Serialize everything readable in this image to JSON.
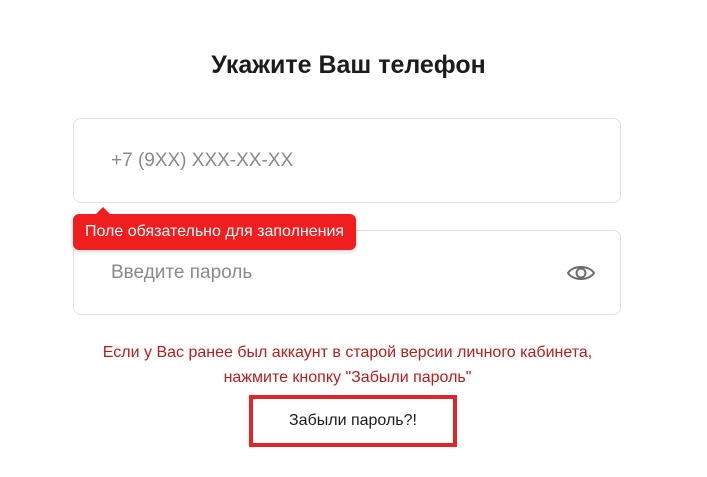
{
  "title": "Укажите Ваш телефон",
  "phone_field": {
    "value": "",
    "placeholder": "+7 (9XX) XXX-XX-XX"
  },
  "validation_tooltip": {
    "text": "Поле обязательно для заполнения",
    "color": "#f01e1e"
  },
  "password_field": {
    "value": "",
    "placeholder": "Введите пароль",
    "toggle_icon": "eye-icon"
  },
  "notice": {
    "text": "Если у Вас ранее был аккаунт в старой версии личного кабинета, нажмите кнопку \"Забыли пароль\"",
    "color": "#b2211e"
  },
  "forgot_button": {
    "label": "Забыли пароль?!",
    "border_color": "#e0262b"
  }
}
